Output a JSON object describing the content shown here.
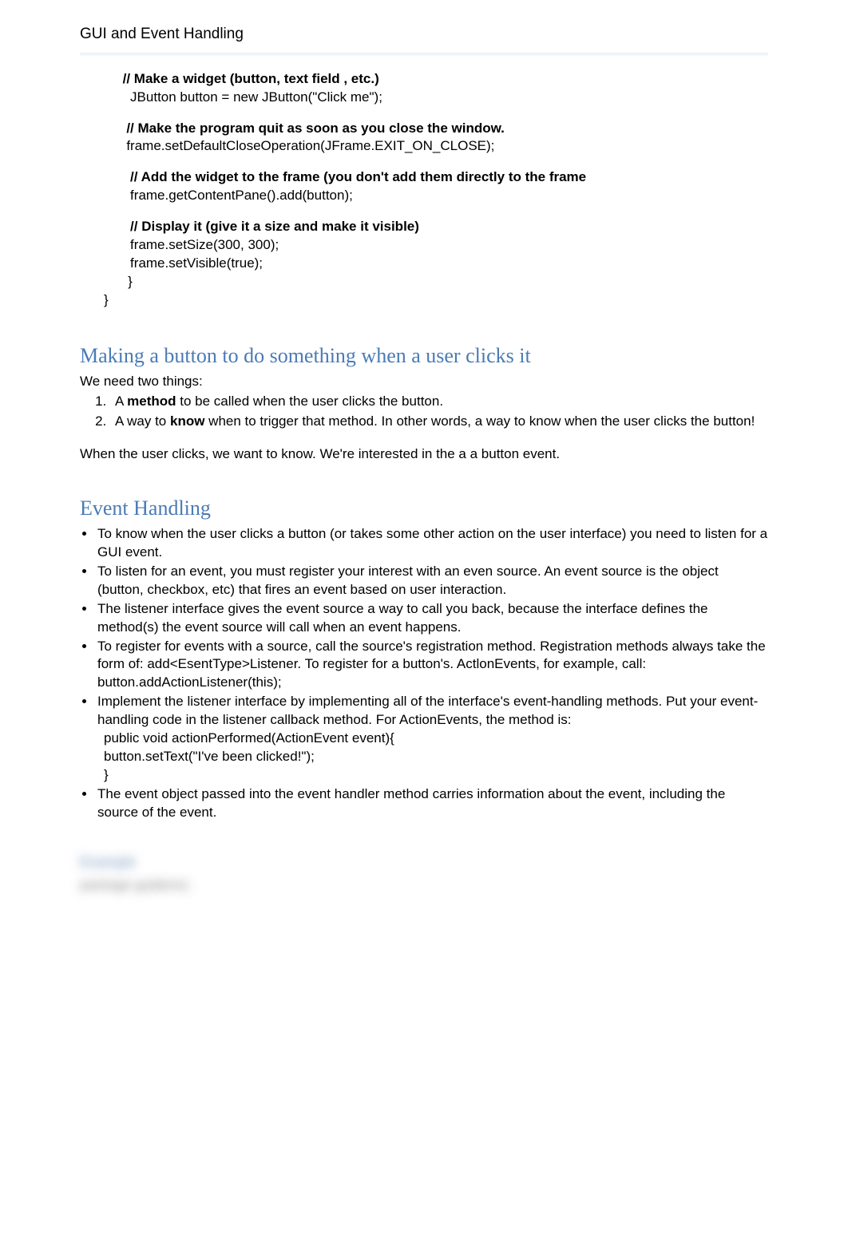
{
  "header": "GUI and Event Handling",
  "code": {
    "c1_comment": "     // Make a widget (button, text field , etc.)",
    "c1_line1": "       JButton button = new JButton(\"Click me\");",
    "c2_comment": "      // Make the program quit as soon as you close the window.",
    "c2_line1": "      frame.setDefaultCloseOperation(JFrame.EXIT_ON_CLOSE);",
    "c3_comment": "       // Add the widget to the frame (you don't add them directly to the frame",
    "c3_line1": "       frame.getContentPane().add(button);",
    "c4_comment": "       // Display it (give it a size and make it visible)",
    "c4_line1": "       frame.setSize(300, 300);",
    "c4_line2": "       frame.setVisible(true);",
    "brace_inner": "   }",
    "brace_outer": "}"
  },
  "section1": {
    "heading": "Making a button to do something when a user clicks it",
    "intro": "We need two things:",
    "item1_pre": "A ",
    "item1_bold": "method",
    "item1_post": " to be called when the user clicks the button.",
    "item2_pre": "A way to ",
    "item2_bold": " know",
    "item2_post": " when to trigger that method. In other words, a way to know when the user clicks the button!",
    "closing": "When the user clicks, we want to know. We're interested in the a a button event."
  },
  "section2": {
    "heading": "Event Handling",
    "b1": "To know when the user clicks a button (or takes some other action on the user interface) you need to listen for a GUI event.",
    "b2": "To listen for an event, you must register your interest with an even source. An event source is the object (button, checkbox, etc) that fires an event based on user interaction.",
    "b3": "The listener interface gives the event source a way to call you back, because the interface defines the method(s) the event source will call when an event happens.",
    "b4": "To register for events with a source, call the source's registration method. Registration methods always take the form of: add<EsentType>Listener. To register for a button's. ActlonEvents,  for example, call:",
    "b4_code": "button.addActionListener(this);",
    "b5": "Implement the listener interface by implementing all of the interface's event-handling methods. Put your event-handling code in the listener callback method. For ActionEvents, the method is:",
    "b5_code1": " public void actionPerformed(ActionEvent event){",
    "b5_code2": "     button.setText(\"I've been clicked!\");",
    "b5_code3": " }",
    "b6": "The event object passed into the event handler method carries information about the event, including the source of the event."
  },
  "blurred": {
    "line1": "Example",
    "line2": "package guidemo;"
  }
}
